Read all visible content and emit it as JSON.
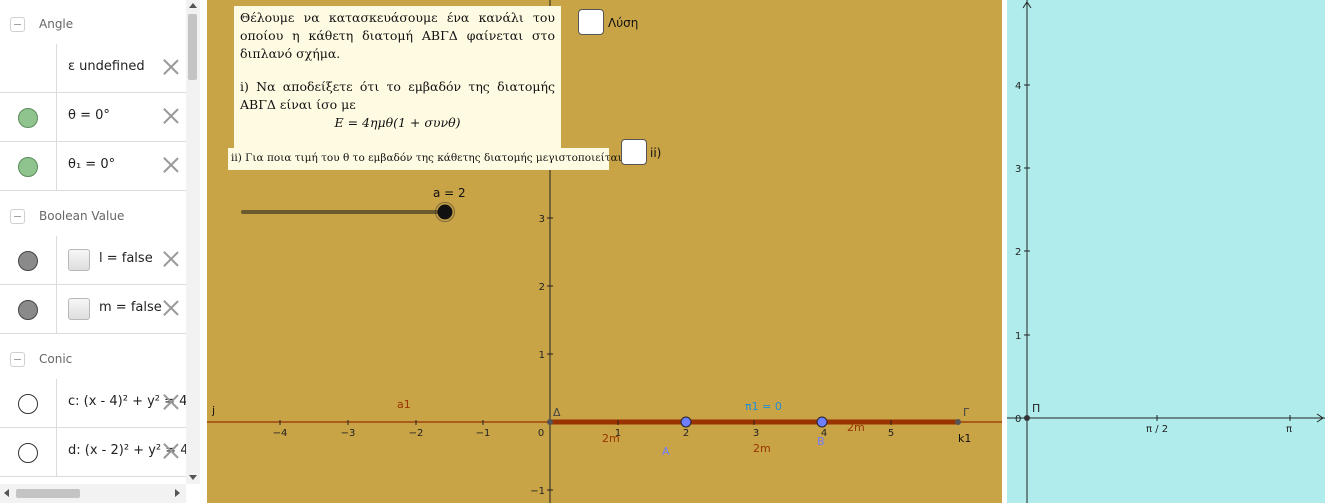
{
  "algebra": {
    "groups": [
      {
        "title": "Angle"
      },
      {
        "title": "Boolean Value"
      },
      {
        "title": "Conic"
      }
    ],
    "rows": [
      {
        "text": "ε undefined",
        "dot": "none"
      },
      {
        "text": "θ = 0°",
        "dot": "green"
      },
      {
        "text": "θ₁ = 0°",
        "dot": "green"
      },
      {
        "text": "l = false",
        "dot": "gray"
      },
      {
        "text": "m = false",
        "dot": "gray"
      },
      {
        "text": "c: (x - 4)² + y² = 4",
        "dot": "hollow"
      },
      {
        "text": "d: (x - 2)² + y² = 4",
        "dot": "hollow"
      }
    ]
  },
  "graphics1": {
    "problem": {
      "intro": "Θέλουμε να κατασκευάσουμε ένα κανάλι του οποίου η κάθετη διατομή ΑΒΓΔ φαίνεται στο διπλανό σχήμα.",
      "part1": "i) Να αποδείξετε ότι το εμβαδόν της διατομής ΑΒΓΔ είναι ίσο με",
      "formula": "E = 4ημθ(1 + συνθ)",
      "part2": "ii) Για ποια τιμή του θ το εμβαδόν της κάθετης διατομής μεγιστοποιείται;"
    },
    "checkboxes": [
      {
        "label": "Λύση"
      },
      {
        "label": "ii)"
      }
    ],
    "slider": {
      "label": "a = 2",
      "value": 2,
      "min": 0,
      "max": 2
    },
    "axes": {
      "x_ticks": [
        "−4",
        "−3",
        "−2",
        "−1",
        "0",
        "1",
        "2",
        "3",
        "4",
        "5"
      ],
      "y_ticks": [
        "−1",
        "1",
        "2",
        "3"
      ]
    },
    "labels": {
      "a1": "a1",
      "j": "j",
      "delta": "Δ",
      "gamma": "Γ",
      "pi1": "π1 = 0",
      "A": "A",
      "B": "B",
      "k1": "k1",
      "m1": "2m",
      "m2": "2m",
      "m3": "2m"
    }
  },
  "graphics2": {
    "y_ticks": [
      "1",
      "2",
      "3",
      "4"
    ],
    "x_ticks": [
      "π / 2",
      "π"
    ],
    "origin": "0",
    "point_label": "Π"
  },
  "colors": {
    "algebra_bg": "#ffffff",
    "graphics1_bg": "#c9a447",
    "graphics2_bg": "#afeceb",
    "segment": "#993300",
    "point": "#6f7dff",
    "label_blue": "#1f8fd6"
  }
}
